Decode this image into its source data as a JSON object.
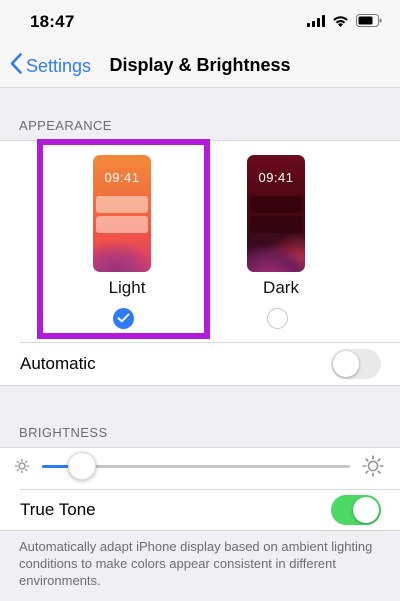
{
  "status_bar": {
    "time": "18:47",
    "icons": [
      "cellular-signal-icon",
      "wifi-icon",
      "battery-icon"
    ]
  },
  "nav": {
    "back_label": "Settings",
    "title": "Display & Brightness"
  },
  "appearance": {
    "header": "APPEARANCE",
    "options": [
      {
        "label": "Light",
        "preview_time": "09:41",
        "selected": true
      },
      {
        "label": "Dark",
        "preview_time": "09:41",
        "selected": false
      }
    ],
    "automatic": {
      "label": "Automatic",
      "enabled": false
    }
  },
  "brightness": {
    "header": "BRIGHTNESS",
    "level": 0.13,
    "true_tone": {
      "label": "True Tone",
      "enabled": true
    },
    "footer": "Automatically adapt iPhone display based on ambient lighting conditions to make colors appear consistent in different environments."
  },
  "colors": {
    "accent": "#2f7bf5",
    "toggle_on": "#4cd964",
    "highlight": "#b31adb"
  }
}
